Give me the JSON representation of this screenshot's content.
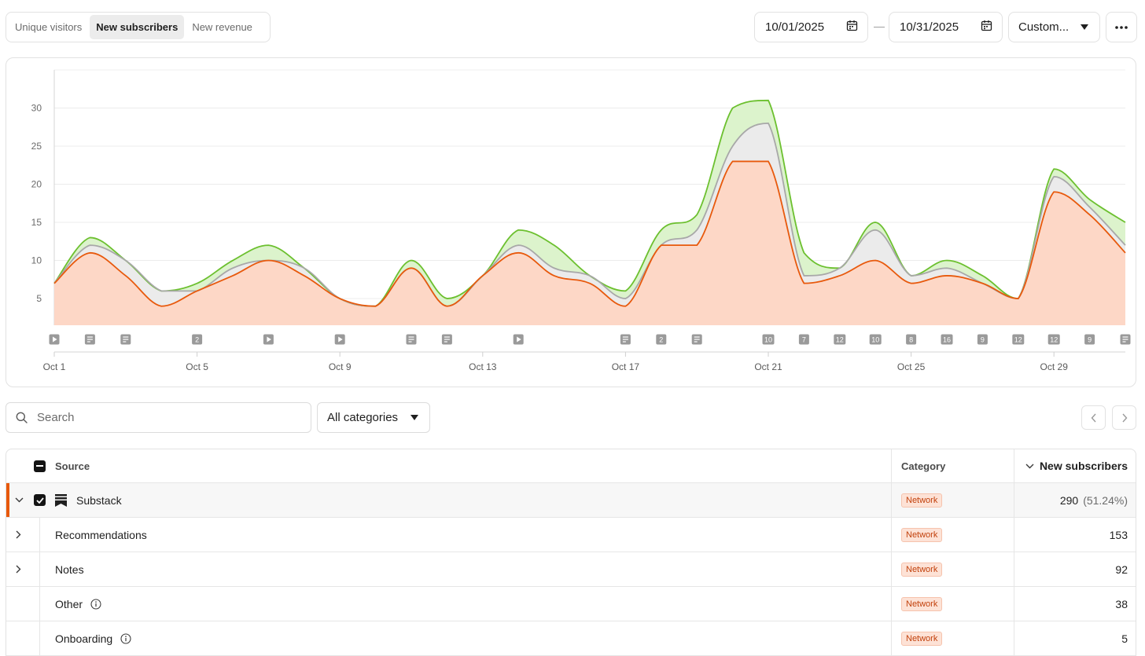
{
  "tabs": [
    {
      "label": "Unique visitors",
      "active": false
    },
    {
      "label": "New subscribers",
      "active": true
    },
    {
      "label": "New revenue",
      "active": false
    }
  ],
  "date_range": {
    "start": "10/01/2025",
    "end": "10/31/2025",
    "separator": "—"
  },
  "range_preset": "Custom...",
  "chart_data": {
    "type": "area",
    "x": [
      "Oct 1",
      "Oct 2",
      "Oct 3",
      "Oct 4",
      "Oct 5",
      "Oct 6",
      "Oct 7",
      "Oct 8",
      "Oct 9",
      "Oct 10",
      "Oct 11",
      "Oct 12",
      "Oct 13",
      "Oct 14",
      "Oct 15",
      "Oct 16",
      "Oct 17",
      "Oct 18",
      "Oct 19",
      "Oct 20",
      "Oct 21",
      "Oct 22",
      "Oct 23",
      "Oct 24",
      "Oct 25",
      "Oct 26",
      "Oct 27",
      "Oct 28",
      "Oct 29",
      "Oct 30",
      "Oct 31"
    ],
    "x_tick_labels": [
      "Oct 1",
      "Oct 5",
      "Oct 9",
      "Oct 13",
      "Oct 17",
      "Oct 21",
      "Oct 25",
      "Oct 29"
    ],
    "y_ticks": [
      5,
      10,
      15,
      20,
      25,
      30
    ],
    "ylim": [
      1.5,
      35
    ],
    "grid": true,
    "series": [
      {
        "color": "#e8590c",
        "fill": "#fdd7c6",
        "values": [
          7,
          11,
          8,
          4,
          6,
          8,
          10,
          8,
          5,
          4,
          9,
          4,
          8,
          11,
          8,
          7,
          4,
          12,
          12,
          23,
          23,
          7,
          8,
          10,
          7,
          8,
          7,
          5,
          19,
          16,
          11
        ]
      },
      {
        "color": "#a8a8a8",
        "fill": "#ebebeb",
        "values": [
          7,
          12,
          10,
          6,
          6,
          9,
          10,
          9,
          5,
          4,
          9,
          4,
          8,
          12,
          9,
          8,
          5,
          12,
          14,
          25,
          28,
          8,
          9,
          14,
          8,
          9,
          7,
          5,
          21,
          17,
          12
        ]
      },
      {
        "color": "#6cc02f",
        "fill": "#dcf3cc",
        "values": [
          7,
          13,
          10,
          6,
          7,
          10,
          12,
          9,
          5,
          4,
          10,
          5,
          8,
          14,
          12,
          8,
          6,
          14,
          16,
          30,
          31,
          11,
          9,
          15,
          8,
          10,
          8,
          5,
          22,
          18,
          15
        ]
      }
    ],
    "markers": [
      {
        "day": 1,
        "type": "video"
      },
      {
        "day": 2,
        "type": "post"
      },
      {
        "day": 3,
        "type": "post"
      },
      {
        "day": 5,
        "type": "count",
        "label": "2"
      },
      {
        "day": 7,
        "type": "video"
      },
      {
        "day": 9,
        "type": "video"
      },
      {
        "day": 11,
        "type": "post"
      },
      {
        "day": 12,
        "type": "post"
      },
      {
        "day": 14,
        "type": "video"
      },
      {
        "day": 17,
        "type": "post"
      },
      {
        "day": 18,
        "type": "count",
        "label": "2"
      },
      {
        "day": 19,
        "type": "post"
      },
      {
        "day": 21,
        "type": "count",
        "label": "10"
      },
      {
        "day": 22,
        "type": "count",
        "label": "7"
      },
      {
        "day": 23,
        "type": "count",
        "label": "12"
      },
      {
        "day": 24,
        "type": "count",
        "label": "10"
      },
      {
        "day": 25,
        "type": "count",
        "label": "8"
      },
      {
        "day": 26,
        "type": "count",
        "label": "16"
      },
      {
        "day": 27,
        "type": "count",
        "label": "9"
      },
      {
        "day": 28,
        "type": "count",
        "label": "12"
      },
      {
        "day": 29,
        "type": "count",
        "label": "12"
      },
      {
        "day": 30,
        "type": "count",
        "label": "9"
      },
      {
        "day": 31,
        "type": "post"
      }
    ]
  },
  "filters": {
    "search_placeholder": "Search",
    "category": "All categories"
  },
  "table": {
    "headers": {
      "source": "Source",
      "category": "Category",
      "metric": "New subscribers"
    },
    "group": {
      "name": "Substack",
      "category": "Network",
      "value": "290",
      "percent": "(51.24%)"
    },
    "rows": [
      {
        "name": "Recommendations",
        "category": "Network",
        "value": "153",
        "expandable": true,
        "info": false
      },
      {
        "name": "Notes",
        "category": "Network",
        "value": "92",
        "expandable": true,
        "info": false
      },
      {
        "name": "Other",
        "category": "Network",
        "value": "38",
        "expandable": false,
        "info": true
      },
      {
        "name": "Onboarding",
        "category": "Network",
        "value": "5",
        "expandable": false,
        "info": true
      }
    ]
  }
}
